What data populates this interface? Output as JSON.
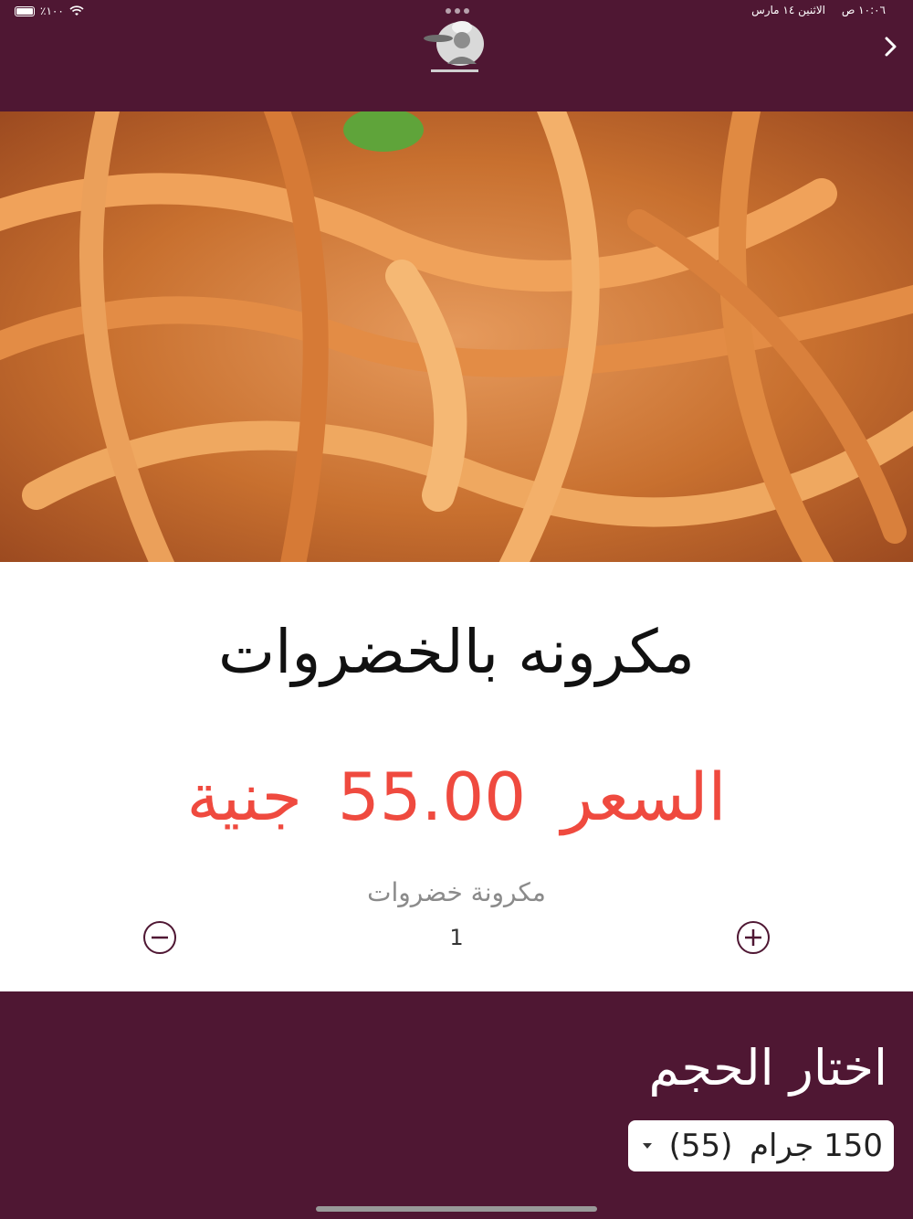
{
  "status_bar": {
    "time": "١٠:٠٦ ص",
    "date": "الاثنين ١٤ مارس",
    "battery": "٪١٠٠"
  },
  "header": {
    "back_icon": "chevron-right-icon",
    "logo_icon": "chef-logo-icon"
  },
  "product": {
    "name": "مكرونه بالخضروات",
    "price_label": "السعر",
    "price_value": "55.00",
    "currency": "جنية",
    "description": "مكرونة خضروات",
    "quantity": "1"
  },
  "size_section": {
    "title": "اختار الحجم",
    "selected_size": "150 جرام",
    "selected_price": "(55)"
  },
  "colors": {
    "primary": "#4f1733",
    "price": "#ef4a3f"
  }
}
